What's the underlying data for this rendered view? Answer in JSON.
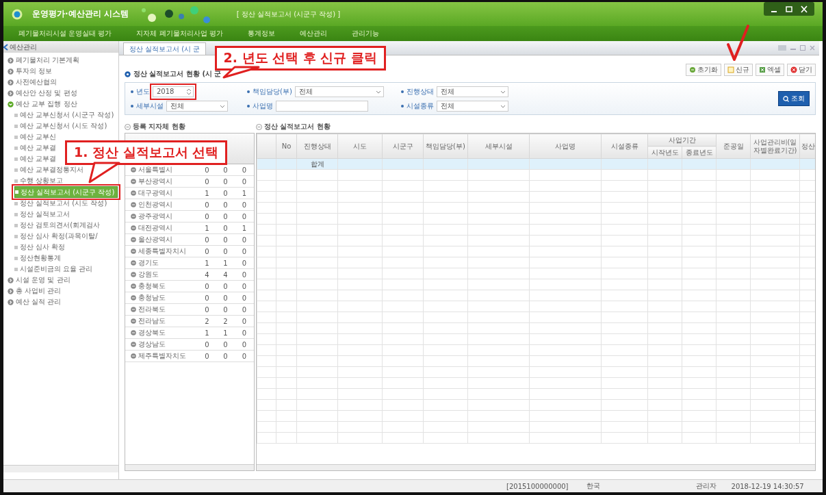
{
  "window": {
    "logo_text": "운영평가·예산관리 시스템",
    "title": "[ 정산 실적보고서 (시군구 작성) ]"
  },
  "menu": [
    "폐기물처리시설 운영실태 평가",
    "지자체 폐기물처리사업 평가",
    "통계정보",
    "예산관리",
    "관리기능"
  ],
  "sidebar": {
    "title": "예산관리",
    "items": [
      {
        "label": "폐기물처리 기본계획",
        "expanded": false,
        "selected": false
      },
      {
        "label": "투자의 정보",
        "expanded": false,
        "selected": false
      },
      {
        "label": "사전예산협의",
        "expanded": false,
        "selected": false
      },
      {
        "label": "예산안 산정 및 편성",
        "expanded": false,
        "selected": false
      },
      {
        "label": "예산 교부 집행 정산",
        "expanded": true,
        "selected": false,
        "children": [
          {
            "label": "예산 교부신청서 (시군구 작성)",
            "selected": false
          },
          {
            "label": "예산 교부신청서 (시도 작성)",
            "selected": false
          },
          {
            "label": "예산 교부신",
            "selected": false
          },
          {
            "label": "예산 교부결",
            "selected": false
          },
          {
            "label": "예산 교부결",
            "selected": false
          },
          {
            "label": "예산 교부결정통지서",
            "selected": false
          },
          {
            "label": "수행 상황보고",
            "selected": false
          },
          {
            "label": "정산 실적보고서 (시군구 작성)",
            "selected": true
          },
          {
            "label": "정산 실적보고서 (시도 작성)",
            "selected": false
          },
          {
            "label": "정산 실적보고서",
            "selected": false
          },
          {
            "label": "정산 검토의견서(회계검사",
            "selected": false
          },
          {
            "label": "정산 심사 확정(과목이탈/",
            "selected": false
          },
          {
            "label": "정산 심사 확정",
            "selected": false
          },
          {
            "label": "정산현황통계",
            "selected": false
          },
          {
            "label": "시설준비금의 요율 관리",
            "selected": false
          }
        ]
      },
      {
        "label": "시설 운영 및 관리",
        "expanded": false,
        "selected": false
      },
      {
        "label": "총 사업비 관리",
        "expanded": false,
        "selected": false
      },
      {
        "label": "예산 실적 관리",
        "expanded": false,
        "selected": false
      }
    ]
  },
  "tabs": [
    {
      "label": "정산 실적보고서 (시 군",
      "selected": true
    }
  ],
  "section_title": "정산 실적보고서 현황 (시 군",
  "toolbar": [
    {
      "label": "초기화",
      "kind": "reset"
    },
    {
      "label": "신규",
      "kind": "new"
    },
    {
      "label": "엑셀",
      "kind": "excel"
    },
    {
      "label": "닫기",
      "kind": "close"
    }
  ],
  "filters": [
    {
      "label": "년도",
      "value": "2018",
      "kind": "spinner"
    },
    {
      "label": "책임담당(부)",
      "value": "전체",
      "kind": "select"
    },
    {
      "label": "진행상태",
      "value": "전체",
      "kind": "select"
    },
    {
      "label": "세부시설",
      "value": "전체",
      "kind": "select"
    },
    {
      "label": "사업명",
      "kind": "text"
    },
    {
      "label": "시설종류",
      "value": "전체",
      "kind": "select"
    }
  ],
  "search_button": "조회",
  "region_panel": {
    "title": "등록 지자체 현황",
    "rows": [
      {
        "name": "서울특별시",
        "values": [
          "0",
          "0",
          "0"
        ]
      },
      {
        "name": "부산광역시",
        "values": [
          "0",
          "0",
          "0"
        ]
      },
      {
        "name": "대구광역시",
        "values": [
          "1",
          "0",
          "1"
        ]
      },
      {
        "name": "인천광역시",
        "values": [
          "0",
          "0",
          "0"
        ]
      },
      {
        "name": "광주광역시",
        "values": [
          "0",
          "0",
          "0"
        ]
      },
      {
        "name": "대전광역시",
        "values": [
          "1",
          "0",
          "1"
        ]
      },
      {
        "name": "울산광역시",
        "values": [
          "0",
          "0",
          "0"
        ]
      },
      {
        "name": "세종특별자치시",
        "values": [
          "0",
          "0",
          "0"
        ]
      },
      {
        "name": "경기도",
        "values": [
          "1",
          "1",
          "0"
        ]
      },
      {
        "name": "강원도",
        "values": [
          "4",
          "4",
          "0"
        ]
      },
      {
        "name": "충청북도",
        "values": [
          "0",
          "0",
          "0"
        ]
      },
      {
        "name": "충청남도",
        "values": [
          "0",
          "0",
          "0"
        ]
      },
      {
        "name": "전라북도",
        "values": [
          "0",
          "0",
          "0"
        ]
      },
      {
        "name": "전라남도",
        "values": [
          "2",
          "2",
          "0"
        ]
      },
      {
        "name": "경상북도",
        "values": [
          "1",
          "1",
          "0"
        ]
      },
      {
        "name": "경상남도",
        "values": [
          "0",
          "0",
          "0"
        ]
      },
      {
        "name": "제주특별자치도",
        "values": [
          "0",
          "0",
          "0"
        ]
      }
    ]
  },
  "report_panel": {
    "title": "정산 실적보고서 현황",
    "columns": [
      {
        "label": "No"
      },
      {
        "label": "진행상태"
      },
      {
        "label": "시도"
      },
      {
        "label": "시군구"
      },
      {
        "label": "책임담당(부)"
      },
      {
        "label": "세부시설"
      },
      {
        "label": "사업명"
      },
      {
        "label": "시설종류"
      },
      {
        "label": "사업기간",
        "children": [
          {
            "label": "시작년도"
          },
          {
            "label": "종료년도"
          }
        ]
      },
      {
        "label": "준공일"
      },
      {
        "label": "사업관리비(일자별완료기간)"
      },
      {
        "label": "정산"
      }
    ],
    "total_label": "합계"
  },
  "status_bar": [
    "[2015100000000]",
    "한국",
    "관리자",
    "2018-12-19 14:30:57"
  ],
  "annotations": [
    {
      "text": "1. 정산 실적보고서 선택"
    },
    {
      "text": "2. 년도 선택 후 신규 클릭"
    }
  ]
}
